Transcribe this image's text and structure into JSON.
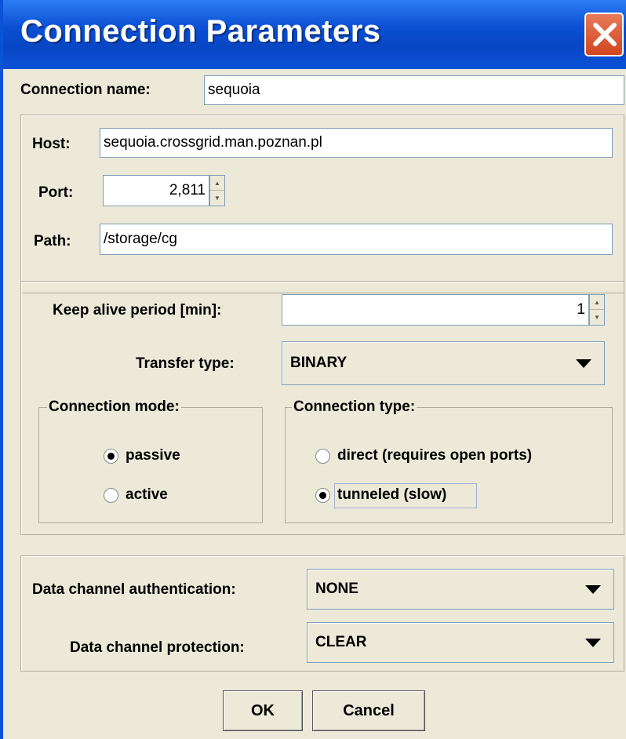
{
  "window": {
    "title": "Connection Parameters",
    "close_icon": "close-icon"
  },
  "connection_name": {
    "label": "Connection name:",
    "value": "sequoia"
  },
  "host": {
    "label": "Host:",
    "value": "sequoia.crossgrid.man.poznan.pl"
  },
  "port": {
    "label": "Port:",
    "value": "2,811"
  },
  "path": {
    "label": "Path:",
    "value": "/storage/cg"
  },
  "keep_alive": {
    "label": "Keep alive period [min]:",
    "value": "1"
  },
  "transfer_type": {
    "label": "Transfer type:",
    "value": "BINARY"
  },
  "connection_mode": {
    "legend": "Connection mode:",
    "options": [
      {
        "label": "passive",
        "selected": true
      },
      {
        "label": "active",
        "selected": false
      }
    ]
  },
  "connection_type": {
    "legend": "Connection type:",
    "options": [
      {
        "label": "direct (requires open ports)",
        "selected": false
      },
      {
        "label": "tunneled (slow)",
        "selected": true
      }
    ]
  },
  "data_channel_auth": {
    "label": "Data channel authentication:",
    "value": "NONE"
  },
  "data_channel_protection": {
    "label": "Data channel protection:",
    "value": "CLEAR"
  },
  "buttons": {
    "ok": "OK",
    "cancel": "Cancel"
  }
}
